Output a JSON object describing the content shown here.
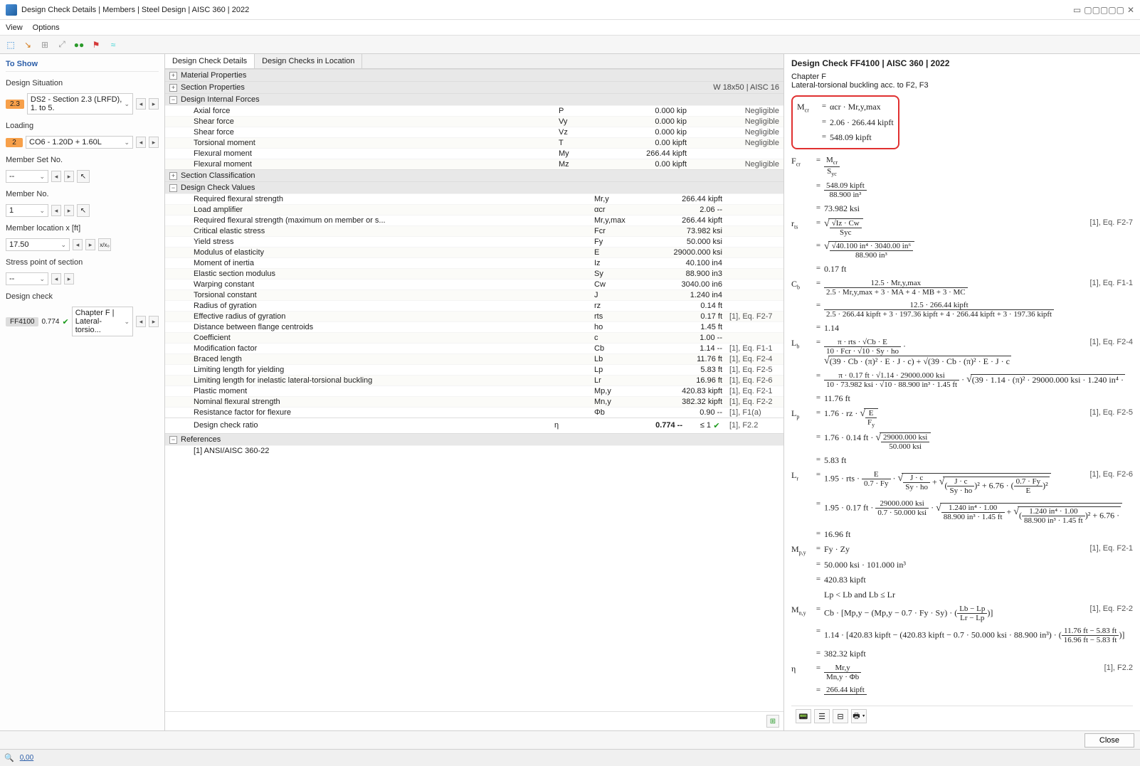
{
  "window": {
    "title": "Design Check Details | Members | Steel Design | AISC 360 | 2022"
  },
  "menu": {
    "view": "View",
    "options": "Options"
  },
  "sidebar": {
    "heading": "To Show",
    "designSituation": {
      "label": "Design Situation",
      "badge": "2.3",
      "value": "DS2 - Section 2.3 (LRFD), 1. to 5."
    },
    "loading": {
      "label": "Loading",
      "badge": "2",
      "value": "CO6 - 1.20D + 1.60L"
    },
    "memberSet": {
      "label": "Member Set No.",
      "value": "-- "
    },
    "memberNo": {
      "label": "Member No.",
      "value": "1 "
    },
    "memberLoc": {
      "label": "Member location x [ft]",
      "value": "17.50"
    },
    "stressPoint": {
      "label": "Stress point of section",
      "value": "-- "
    },
    "designCheck": {
      "label": "Design check",
      "badge": "FF4100",
      "ratio": "0.774",
      "value": "Chapter F | Lateral-torsio..."
    }
  },
  "tabs": {
    "t1": "Design Check Details",
    "t2": "Design Checks in Location"
  },
  "sections": {
    "matProps": "Material Properties",
    "secProps": "Section Properties",
    "secPropsRight": "W 18x50 | AISC 16",
    "internalForces": "Design Internal Forces",
    "classification": "Section Classification",
    "checkValues": "Design Check Values",
    "references": "References"
  },
  "forces": [
    {
      "n": "Axial force",
      "s": "P",
      "v": "0.000 kip",
      "note": "Negligible"
    },
    {
      "n": "Shear force",
      "s": "Vy",
      "v": "0.000 kip",
      "note": "Negligible"
    },
    {
      "n": "Shear force",
      "s": "Vz",
      "v": "0.000 kip",
      "note": "Negligible"
    },
    {
      "n": "Torsional moment",
      "s": "T",
      "v": "0.00 kipft",
      "note": "Negligible"
    },
    {
      "n": "Flexural moment",
      "s": "My",
      "v": "266.44 kipft",
      "note": ""
    },
    {
      "n": "Flexural moment",
      "s": "Mz",
      "v": "0.00 kipft",
      "note": "Negligible"
    }
  ],
  "checks": [
    {
      "n": "Required flexural strength",
      "s": "Mr,y",
      "v": "266.44 kipft",
      "ref": ""
    },
    {
      "n": "Load amplifier",
      "s": "αcr",
      "v": "2.06 --",
      "ref": ""
    },
    {
      "n": "Required flexural strength (maximum on member or s...",
      "s": "Mr,y,max",
      "v": "266.44 kipft",
      "ref": ""
    },
    {
      "n": "Critical elastic stress",
      "s": "Fcr",
      "v": "73.982 ksi",
      "ref": ""
    },
    {
      "n": "Yield stress",
      "s": "Fy",
      "v": "50.000 ksi",
      "ref": ""
    },
    {
      "n": "Modulus of elasticity",
      "s": "E",
      "v": "29000.000 ksi",
      "ref": ""
    },
    {
      "n": "Moment of inertia",
      "s": "Iz",
      "v": "40.100 in4",
      "ref": ""
    },
    {
      "n": "Elastic section modulus",
      "s": "Sy",
      "v": "88.900 in3",
      "ref": ""
    },
    {
      "n": "Warping constant",
      "s": "Cw",
      "v": "3040.00 in6",
      "ref": ""
    },
    {
      "n": "Torsional constant",
      "s": "J",
      "v": "1.240 in4",
      "ref": ""
    },
    {
      "n": "Radius of gyration",
      "s": "rz",
      "v": "0.14 ft",
      "ref": ""
    },
    {
      "n": "Effective radius of gyration",
      "s": "rts",
      "v": "0.17 ft",
      "ref": "[1], Eq. F2-7"
    },
    {
      "n": "Distance between flange centroids",
      "s": "ho",
      "v": "1.45 ft",
      "ref": ""
    },
    {
      "n": "Coefficient",
      "s": "c",
      "v": "1.00 --",
      "ref": ""
    },
    {
      "n": "Modification factor",
      "s": "Cb",
      "v": "1.14 --",
      "ref": "[1], Eq. F1-1"
    },
    {
      "n": "Braced length",
      "s": "Lb",
      "v": "11.76 ft",
      "ref": "[1], Eq. F2-4"
    },
    {
      "n": "Limiting length for yielding",
      "s": "Lp",
      "v": "5.83 ft",
      "ref": "[1], Eq. F2-5"
    },
    {
      "n": "Limiting length for inelastic lateral-torsional buckling",
      "s": "Lr",
      "v": "16.96 ft",
      "ref": "[1], Eq. F2-6"
    },
    {
      "n": "Plastic moment",
      "s": "Mp,y",
      "v": "420.83 kipft",
      "ref": "[1], Eq. F2-1"
    },
    {
      "n": "Nominal flexural strength",
      "s": "Mn,y",
      "v": "382.32 kipft",
      "ref": "[1], Eq. F2-2"
    },
    {
      "n": "Resistance factor for flexure",
      "s": "Φb",
      "v": "0.90 --",
      "ref": "[1], F1(a)"
    }
  ],
  "ratio": {
    "n": "Design check ratio",
    "s": "η",
    "v": "0.774 --",
    "lim": "≤ 1",
    "ref": "[1], F2.2"
  },
  "reference": "[1]  ANSI/AISC 360-22",
  "right": {
    "title": "Design Check FF4100 | AISC 360 | 2022",
    "chapter": "Chapter F",
    "subtitle": "Lateral-torsional buckling acc. to F2, F3",
    "hl1": "αcr  ·  Mr,y,max",
    "hl2": "2.06  ·  266.44 kipft",
    "hl3": "548.09 kipft",
    "fcr_num": "548.09 kipft",
    "fcr_den": "88.900 in³",
    "fcr_val": "73.982 ksi",
    "rts_num": "Iz  ·  Cw",
    "rts_den": "Syc",
    "rts_num2": "40.100 in⁴  ·  3040.00 in⁶",
    "rts_den2": "88.900 in³",
    "rts_val": "0.17 ft",
    "cb_num": "12.5  ·  Mr,y,max",
    "cb_den": "2.5  ·  Mr,y,max  +  3  ·  MA  +  4  ·  MB  +  3  ·  MC",
    "cb_num2": "12.5  ·  266.44 kipft",
    "cb_den2": "2.5  ·  266.44 kipft  +  3  ·  197.36 kipft  +  4  ·  266.44 kipft  +  3  ·  197.36 kipft",
    "cb_val": "1.14",
    "lb_line1": "π  ·  rts  ·  √Cb  ·  E",
    "lb_line1d": "10  ·  Fcr  ·  √10  ·  Sy  ·  ho",
    "lb_line1r": "(39  ·  Cb  ·  (π)²  ·  E  ·  J  ·  c)  +  √(39  ·  Cb  ·  (π)²  ·  E  ·  J  · c",
    "lb_line2n": "π  ·  0.17 ft  ·  √1.14  ·  29000.000 ksi",
    "lb_line2d": "10  ·  73.982 ksi  ·  √10  ·  88.900 in³  ·  1.45 ft",
    "lb_line2r": "(39  ·  1.14  ·  (π)²  ·  29000.000 ksi  ·  1.240 in⁴  · ",
    "lb_val": "11.76 ft",
    "lp_eq": "1.76  ·  rz  ·  ",
    "lp_sqrt": "E / Fy",
    "lp2": "1.76  ·  0.14 ft  ·  ",
    "lp2_num": "29000.000 ksi",
    "lp2_den": "50.000 ksi",
    "lp_val": "5.83 ft",
    "lr_pre": "1.95  ·  rts  ·  ",
    "lr_f1n": "E",
    "lr_f1d": "0.7  ·  Fy",
    "lr_f2n": "J  ·  c",
    "lr_f2d": "Sy  ·  ho",
    "lr_f3n": "J  ·  c",
    "lr_f3d": "Sy  ·  ho",
    "lr_const": "  +  6.76  ·  ",
    "lr_f4n": "0.7  ·  Fy",
    "lr_f4d": "E",
    "lr2_pre": "1.95  ·  0.17 ft  ·  ",
    "lr2_f1n": "29000.000 ksi",
    "lr2_f1d": "0.7  ·  50.000 ksi",
    "lr2_f2n": "1.240 in⁴  ·  1.00",
    "lr2_f2d": "88.900 in³  ·  1.45 ft",
    "lr2_f3n": "1.240 in⁴  ·  1.00",
    "lr2_f3d": "88.900 in³  ·  1.45 ft",
    "lr_val": "16.96 ft",
    "mpy_eq": "Fy  ·  Zy",
    "mpy2": "50.000 ksi  ·  101.000 in³",
    "mpy_val": "420.83 kipft",
    "cond": "Lp  <  Lb  and  Lb  ≤  Lr",
    "mny_pre": "Cb  ·  ",
    "mny_body": "Mp,y  −  (Mp,y  −  0.7  ·  Fy  ·  Sy)  ·  ",
    "mny_fn": "Lb  −  Lp",
    "mny_fd": "Lr  −  Lp",
    "mny2_pre": "1.14  ·  ",
    "mny2_body": "420.83 kipft  −  (420.83 kipft  −  0.7  ·  50.000 ksi  ·  88.900 in³)  ·  ",
    "mny2_fn": "11.76 ft  −  5.83 ft",
    "mny2_fd": "16.96 ft  −  5.83 ft",
    "mny_val": "382.32 kipft",
    "eta_n": "Mr,y",
    "eta_d": "Mn,y  ·  Φb",
    "eta2": "266.44 kipft",
    "refs": {
      "f27": "[1], Eq. F2-7",
      "f11": "[1], Eq. F1-1",
      "f24": "[1], Eq. F2-4",
      "f25": "[1], Eq. F2-5",
      "f26": "[1], Eq. F2-6",
      "f21": "[1], Eq. F2-1",
      "f22": "[1], Eq. F2-2",
      "f22s": "[1], F2.2"
    }
  },
  "footer": {
    "close": "Close"
  }
}
